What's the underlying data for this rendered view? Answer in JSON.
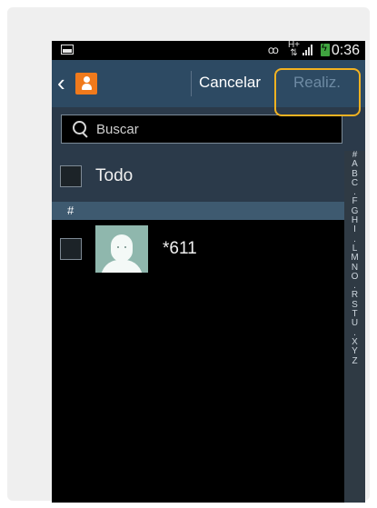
{
  "status_bar": {
    "time": "0:36",
    "network": "H+",
    "icons": [
      "screenshot-icon",
      "vibrate-icon",
      "network-icon",
      "signal-icon",
      "battery-charging-icon"
    ]
  },
  "action_bar": {
    "back_icon": "back-icon",
    "app_icon": "contacts-icon",
    "cancel_label": "Cancelar",
    "done_label": "Realiz."
  },
  "search": {
    "placeholder": "Buscar"
  },
  "select_all": {
    "label": "Todo",
    "checked": false
  },
  "sections": [
    {
      "header": "#",
      "contacts": [
        {
          "name": "*611",
          "checked": false,
          "avatar": "default-avatar"
        }
      ]
    }
  ],
  "index_letters": [
    "#",
    "A",
    "B",
    "C",
    ".",
    "F",
    "G",
    "H",
    "I",
    ".",
    "L",
    "M",
    "N",
    "O",
    ".",
    "R",
    "S",
    "T",
    "U",
    ".",
    "X",
    "Y",
    "Z"
  ],
  "colors": {
    "action_bar": "#2d4a63",
    "highlight": "#f3b221",
    "contacts_icon": "#f07a1c"
  }
}
